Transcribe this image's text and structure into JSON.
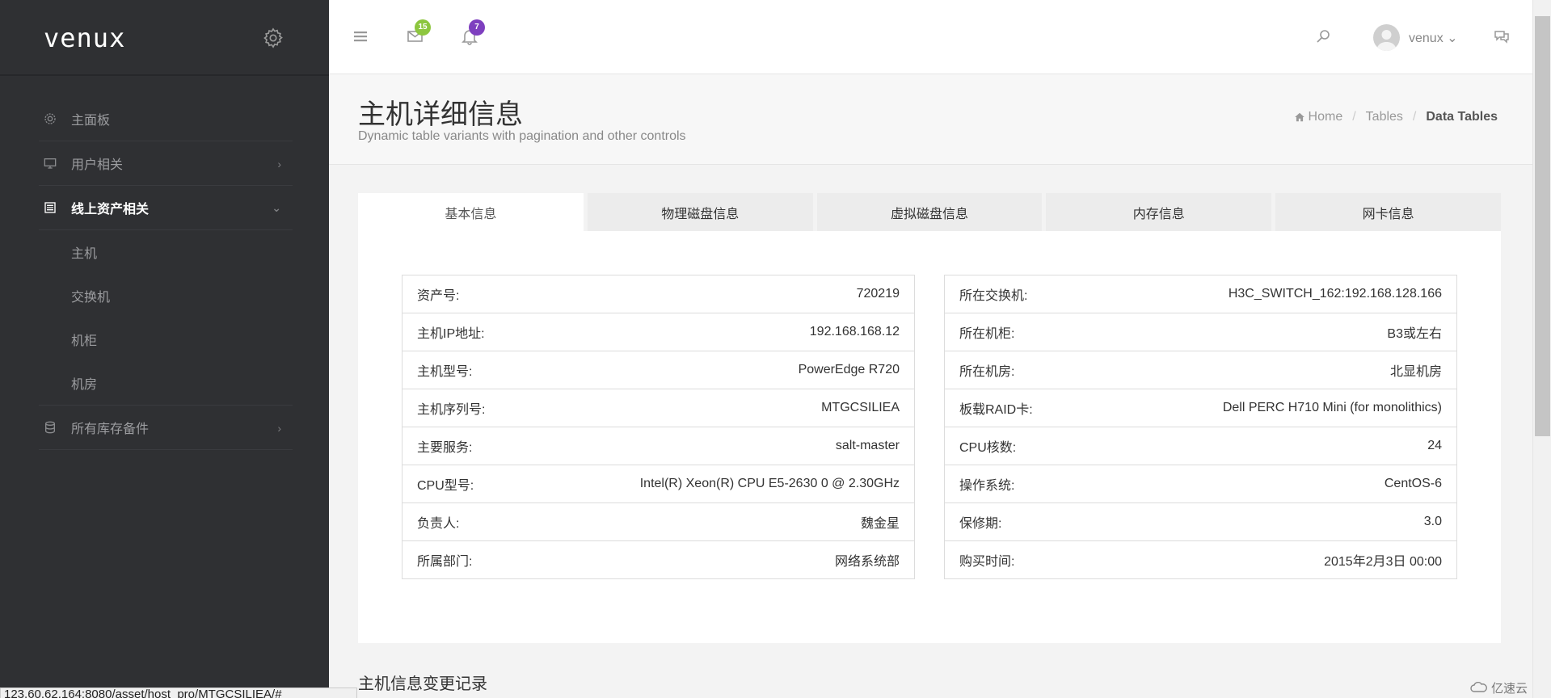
{
  "brand": {
    "name": "venux"
  },
  "sidebar": {
    "items": [
      {
        "label": "主面板",
        "icon": "dashboard-gear-icon"
      },
      {
        "label": "用户相关",
        "icon": "monitor-icon",
        "chevron": "›"
      },
      {
        "label": "线上资产相关",
        "icon": "server-list-icon",
        "chevron": "⌄"
      },
      {
        "label": "所有库存备件",
        "icon": "database-icon",
        "chevron": "›"
      }
    ],
    "subitems": [
      "主机",
      "交换机",
      "机柜",
      "机房"
    ]
  },
  "topbar": {
    "mail_badge": "15",
    "bell_badge": "7",
    "user_name": "venux",
    "user_caret": "⌄"
  },
  "header": {
    "title": "主机详细信息",
    "subtitle": "Dynamic table variants with pagination and other controls",
    "breadcrumb": [
      "Home",
      "Tables",
      "Data Tables"
    ],
    "sep": "/"
  },
  "tabs": [
    "基本信息",
    "物理磁盘信息",
    "虚拟磁盘信息",
    "内存信息",
    "网卡信息"
  ],
  "left_table": [
    {
      "k": "资产号:",
      "v": "720219"
    },
    {
      "k": "主机IP地址:",
      "v": "192.168.168.12"
    },
    {
      "k": "主机型号:",
      "v": "PowerEdge R720"
    },
    {
      "k": "主机序列号:",
      "v": "MTGCSILIEA"
    },
    {
      "k": "主要服务:",
      "v": "salt-master"
    },
    {
      "k": "CPU型号:",
      "v": "Intel(R) Xeon(R) CPU E5-2630 0 @ 2.30GHz"
    },
    {
      "k": "负责人:",
      "v": "魏金星"
    },
    {
      "k": "所属部门:",
      "v": "网络系统部"
    }
  ],
  "right_table": [
    {
      "k": "所在交换机:",
      "v": "H3C_SWITCH_162:192.168.128.166"
    },
    {
      "k": "所在机柜:",
      "v": "B3或左右"
    },
    {
      "k": "所在机房:",
      "v": "北显机房"
    },
    {
      "k": "板载RAID卡:",
      "v": "Dell PERC H710 Mini (for monolithics)"
    },
    {
      "k": "CPU核数:",
      "v": "24"
    },
    {
      "k": "操作系统:",
      "v": "CentOS-6"
    },
    {
      "k": "保修期:",
      "v": "3.0"
    },
    {
      "k": "购买时间:",
      "v": "2015年2月3日 00:00"
    }
  ],
  "section_title": "主机信息变更记录",
  "status_url": "123.60.62.164:8080/asset/host_pro/MTGCSILIEA/#",
  "watermark": "亿速云",
  "colors": {
    "sidebar_bg": "#2f3033",
    "mail_badge": "#8dc63f",
    "bell_badge": "#7e3fbf"
  }
}
